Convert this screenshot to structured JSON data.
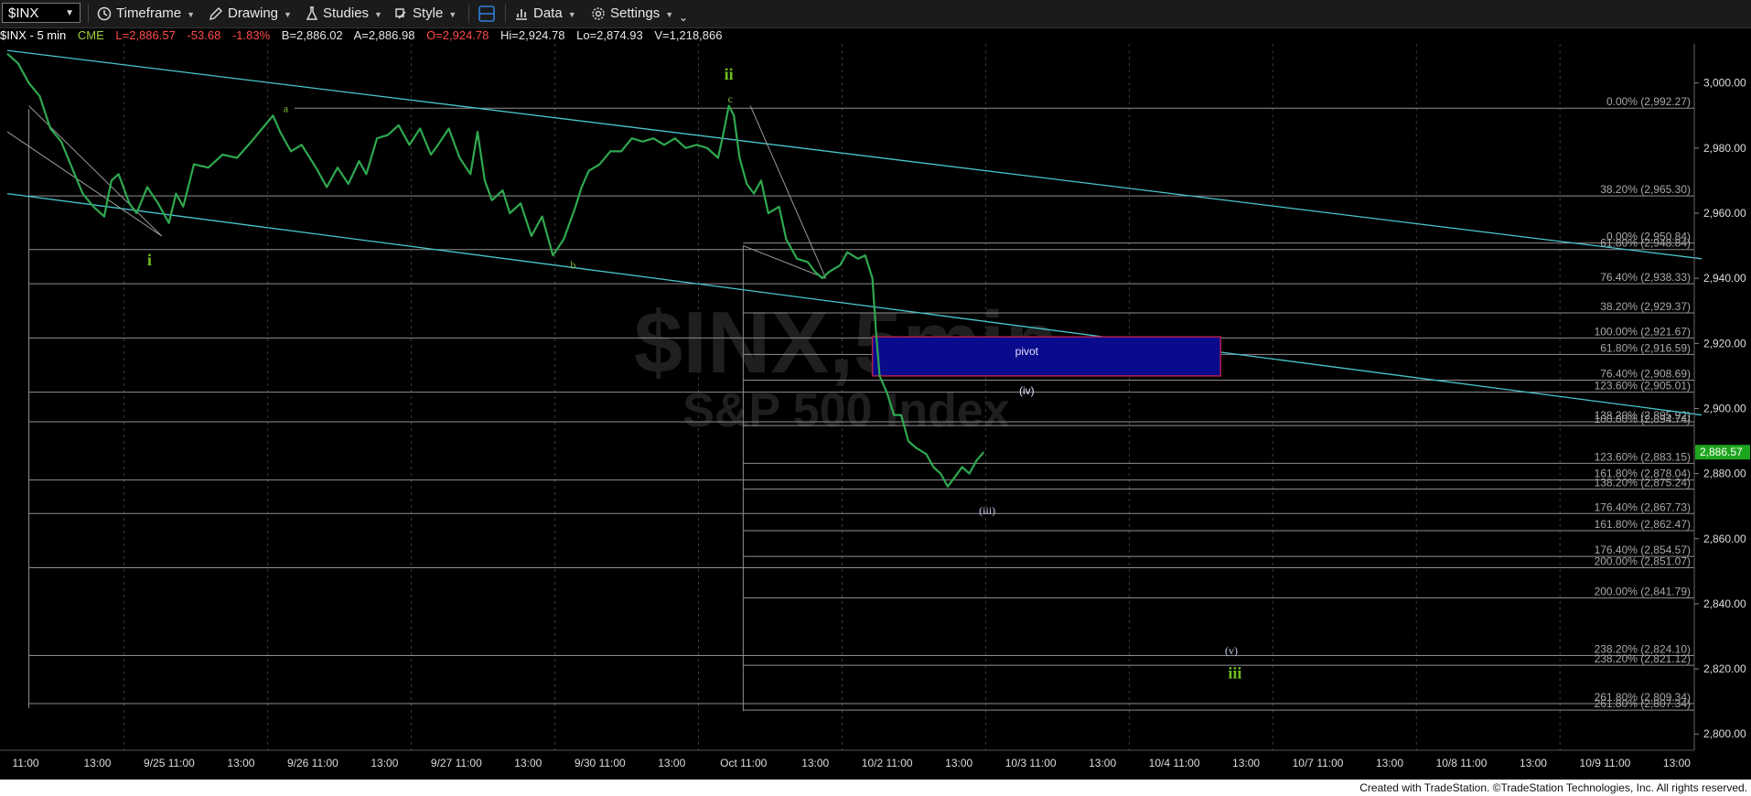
{
  "toolbar": {
    "symbol": "$INX",
    "timeframe": "Timeframe",
    "drawing": "Drawing",
    "studies": "Studies",
    "style": "Style",
    "data": "Data",
    "settings": "Settings"
  },
  "info": {
    "symbol": "$INX - 5 min",
    "exchange": "CME",
    "last": "L=2,886.57",
    "change": "-53.68",
    "change_pct": "-1.83%",
    "bid": "B=2,886.02",
    "ask": "A=2,886.98",
    "open": "O=2,924.78",
    "high": "Hi=2,924.78",
    "low": "Lo=2,874.93",
    "volume": "V=1,218,866"
  },
  "watermark": {
    "symbol": "$INX,5min",
    "name": "S&P 500 Index"
  },
  "last_price_tag": "2,886.57",
  "footer": "Created with TradeStation. ©TradeStation Technologies, Inc. All rights reserved.",
  "colors": {
    "background": "#000000",
    "price": "#2fa84f",
    "trendline": "#48c5cf",
    "fib": "#8f8f8f",
    "wave_green": "#6fbf1f",
    "pivot_fill": "#0a0a8c",
    "pivot_border": "#b02050",
    "negative": "#ff4a4a",
    "info_label": "#9fd040"
  },
  "chart_data": {
    "type": "line",
    "title": "$INX - 5 min",
    "ylim": [
      2795,
      3012
    ],
    "yticks": [
      "3,000.00",
      "2,980.00",
      "2,960.00",
      "2,940.00",
      "2,920.00",
      "2,900.00",
      "2,880.00",
      "2,860.00",
      "2,840.00",
      "2,820.00",
      "2,800.00"
    ],
    "ytick_values": [
      3000,
      2980,
      2960,
      2940,
      2920,
      2900,
      2880,
      2860,
      2840,
      2820,
      2800
    ],
    "x_labels": [
      "11:00",
      "13:00",
      "9/25 11:00",
      "13:00",
      "9/26 11:00",
      "13:00",
      "9/27 11:00",
      "13:00",
      "9/30 11:00",
      "13:00",
      "Oct 11:00",
      "13:00",
      "10/2 11:00",
      "13:00",
      "10/3 11:00",
      "13:00",
      "10/4 11:00",
      "13:00",
      "10/7 11:00",
      "13:00",
      "10/8 11:00",
      "13:00",
      "10/9 11:00",
      "13:00"
    ],
    "x_session_starts": [
      2,
      4,
      6,
      8,
      10,
      12,
      14,
      16,
      18,
      20,
      22
    ],
    "n_slots": 23.6,
    "series": [
      {
        "points": [
          [
            0.0,
            3009
          ],
          [
            0.15,
            3006
          ],
          [
            0.3,
            3000
          ],
          [
            0.45,
            2996
          ],
          [
            0.6,
            2986
          ],
          [
            0.75,
            2982
          ],
          [
            0.9,
            2974
          ],
          [
            1.05,
            2966
          ],
          [
            1.2,
            2962
          ],
          [
            1.35,
            2959
          ],
          [
            1.45,
            2970
          ],
          [
            1.55,
            2972
          ],
          [
            1.7,
            2963
          ],
          [
            1.8,
            2960
          ],
          [
            1.95,
            2968
          ],
          [
            2.1,
            2963
          ],
          [
            2.25,
            2957
          ],
          [
            2.35,
            2966
          ],
          [
            2.45,
            2962
          ],
          [
            2.6,
            2975
          ],
          [
            2.8,
            2974
          ],
          [
            3.0,
            2978
          ],
          [
            3.2,
            2977
          ],
          [
            3.4,
            2982
          ],
          [
            3.55,
            2986
          ],
          [
            3.7,
            2990
          ],
          [
            3.8,
            2985
          ],
          [
            3.95,
            2979
          ],
          [
            4.1,
            2981
          ],
          [
            4.3,
            2974
          ],
          [
            4.45,
            2968
          ],
          [
            4.6,
            2974
          ],
          [
            4.75,
            2969
          ],
          [
            4.9,
            2976
          ],
          [
            5.0,
            2972
          ],
          [
            5.15,
            2983
          ],
          [
            5.3,
            2984
          ],
          [
            5.45,
            2987
          ],
          [
            5.6,
            2981
          ],
          [
            5.75,
            2986
          ],
          [
            5.9,
            2978
          ],
          [
            6.0,
            2981
          ],
          [
            6.15,
            2986
          ],
          [
            6.3,
            2977
          ],
          [
            6.45,
            2972
          ],
          [
            6.55,
            2985
          ],
          [
            6.65,
            2970
          ],
          [
            6.75,
            2964
          ],
          [
            6.9,
            2967
          ],
          [
            7.0,
            2960
          ],
          [
            7.15,
            2963
          ],
          [
            7.3,
            2953
          ],
          [
            7.45,
            2959
          ],
          [
            7.6,
            2947
          ],
          [
            7.75,
            2952
          ],
          [
            7.9,
            2961
          ],
          [
            8.0,
            2968
          ],
          [
            8.1,
            2973
          ],
          [
            8.25,
            2975
          ],
          [
            8.4,
            2979
          ],
          [
            8.55,
            2979
          ],
          [
            8.7,
            2983
          ],
          [
            8.85,
            2982
          ],
          [
            9.0,
            2983
          ],
          [
            9.15,
            2981
          ],
          [
            9.3,
            2983
          ],
          [
            9.45,
            2980
          ],
          [
            9.6,
            2981
          ],
          [
            9.75,
            2980
          ],
          [
            9.9,
            2977
          ],
          [
            9.97,
            2984
          ],
          [
            10.05,
            2993
          ],
          [
            10.12,
            2990
          ],
          [
            10.2,
            2977
          ],
          [
            10.3,
            2969
          ],
          [
            10.4,
            2966
          ],
          [
            10.5,
            2970
          ],
          [
            10.6,
            2960
          ],
          [
            10.75,
            2962
          ],
          [
            10.85,
            2952
          ],
          [
            11.0,
            2946
          ],
          [
            11.15,
            2945
          ],
          [
            11.25,
            2942
          ],
          [
            11.35,
            2940
          ],
          [
            11.45,
            2942
          ],
          [
            11.6,
            2944
          ],
          [
            11.7,
            2948
          ],
          [
            11.85,
            2946
          ],
          [
            11.95,
            2947
          ],
          [
            12.05,
            2940
          ],
          [
            12.1,
            2924
          ],
          [
            12.15,
            2910
          ],
          [
            12.25,
            2905
          ],
          [
            12.35,
            2898
          ],
          [
            12.45,
            2898
          ],
          [
            12.55,
            2890
          ],
          [
            12.65,
            2888
          ],
          [
            12.8,
            2886
          ],
          [
            12.9,
            2882
          ],
          [
            13.0,
            2880
          ],
          [
            13.1,
            2876
          ],
          [
            13.2,
            2879
          ],
          [
            13.3,
            2882
          ],
          [
            13.4,
            2880
          ],
          [
            13.5,
            2884
          ],
          [
            13.6,
            2886.57
          ]
        ]
      }
    ],
    "trendlines": [
      {
        "from": [
          0.0,
          3010
        ],
        "to": [
          23.6,
          2946
        ]
      },
      {
        "from": [
          0.0,
          2966
        ],
        "to": [
          23.6,
          2898
        ]
      },
      {
        "from": [
          0.0,
          2985
        ],
        "to": [
          2.15,
          2953
        ]
      },
      {
        "from": [
          0.3,
          2993
        ],
        "to": [
          2.15,
          2953
        ]
      },
      {
        "from": [
          10.35,
          2993
        ],
        "to": [
          11.4,
          2940
        ]
      },
      {
        "from": [
          10.25,
          2950
        ],
        "to": [
          11.4,
          2940
        ]
      }
    ],
    "fib_lines": [
      {
        "y": 2992.27,
        "x0": 4.0,
        "label": "0.00% (2,992.27)"
      },
      {
        "y": 2965.3,
        "x0": 0.3,
        "label": "38.20% (2,965.30)"
      },
      {
        "y": 2950.84,
        "x0": 10.25,
        "label": "0.00% (2,950.84)"
      },
      {
        "y": 2948.84,
        "x0": 0.3,
        "label": "61.80% (2,948.84)"
      },
      {
        "y": 2938.33,
        "x0": 0.3,
        "label": "76.40% (2,938.33)"
      },
      {
        "y": 2929.37,
        "x0": 10.25,
        "label": "38.20% (2,929.37)"
      },
      {
        "y": 2921.67,
        "x0": 0.3,
        "label": "100.00% (2,921.67)"
      },
      {
        "y": 2916.59,
        "x0": 10.25,
        "label": "61.80% (2,916.59)"
      },
      {
        "y": 2908.69,
        "x0": 10.25,
        "label": "76.40% (2,908.69)"
      },
      {
        "y": 2905.01,
        "x0": 0.3,
        "label": "123.60% (2,905.01)"
      },
      {
        "y": 2895.92,
        "x0": 0.3,
        "label": "138.20% (2,895.92)"
      },
      {
        "y": 2894.74,
        "x0": 10.25,
        "label": "100.00% (2,894.74)"
      },
      {
        "y": 2883.15,
        "x0": 10.25,
        "label": "123.60% (2,883.15)"
      },
      {
        "y": 2878.04,
        "x0": 0.3,
        "label": "161.80% (2,878.04)"
      },
      {
        "y": 2875.24,
        "x0": 10.25,
        "label": "138.20% (2,875.24)"
      },
      {
        "y": 2867.73,
        "x0": 0.3,
        "label": "176.40% (2,867.73)"
      },
      {
        "y": 2862.47,
        "x0": 10.25,
        "label": "161.80% (2,862.47)"
      },
      {
        "y": 2854.57,
        "x0": 10.25,
        "label": "176.40% (2,854.57)"
      },
      {
        "y": 2851.07,
        "x0": 0.3,
        "label": "200.00% (2,851.07)"
      },
      {
        "y": 2841.79,
        "x0": 10.25,
        "label": "200.00% (2,841.79)"
      },
      {
        "y": 2824.1,
        "x0": 0.3,
        "label": "238.20% (2,824.10)"
      },
      {
        "y": 2821.12,
        "x0": 10.25,
        "label": "238.20% (2,821.12)"
      },
      {
        "y": 2809.34,
        "x0": 0.3,
        "label": "261.80% (2,809.34)"
      },
      {
        "y": 2807.34,
        "x0": 10.25,
        "label": "261.80% (2,807.34)"
      }
    ],
    "fib_verticals": [
      {
        "x": 0.3,
        "y0": 2992,
        "y1": 2808
      },
      {
        "x": 10.25,
        "y0": 2950,
        "y1": 2807
      }
    ],
    "pivot_box": {
      "x0": 12.05,
      "x1": 16.9,
      "y0": 2910,
      "y1": 2922
    },
    "pivot_labels": [
      {
        "text": "pivot",
        "x": 14.2,
        "y": 2917.5
      },
      {
        "text": "(iv)",
        "x": 14.2,
        "y": 2905.5
      }
    ],
    "wave_labels": [
      {
        "text": "i",
        "x": 1.98,
        "y": 2944,
        "style": "green"
      },
      {
        "text": "ii",
        "x": 10.05,
        "y": 3001,
        "style": "green"
      },
      {
        "text": "iii",
        "x": 17.1,
        "y": 2817,
        "style": "green"
      },
      {
        "text": "a",
        "x": 3.88,
        "y": 2991,
        "style": "small"
      },
      {
        "text": "b",
        "x": 7.88,
        "y": 2943,
        "style": "small"
      },
      {
        "text": "c",
        "x": 10.07,
        "y": 2994,
        "style": "small"
      },
      {
        "text": "(iii)",
        "x": 13.65,
        "y": 2867.5,
        "style": "paren"
      },
      {
        "text": "(v)",
        "x": 17.05,
        "y": 2824.5,
        "style": "paren"
      }
    ]
  }
}
